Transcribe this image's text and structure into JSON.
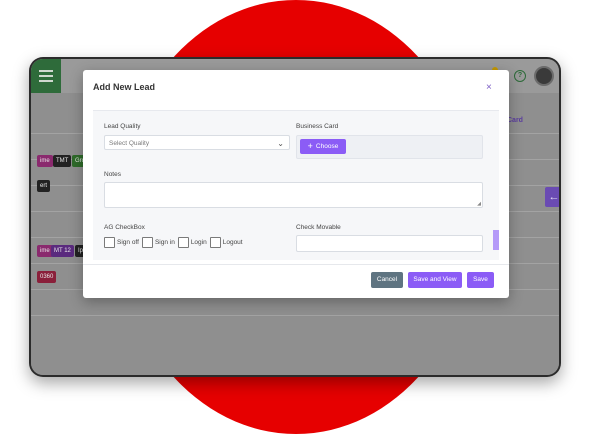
{
  "background": {
    "circle_color": "#e60000"
  },
  "app": {
    "help_icon": "question-circle-icon",
    "bg_table_header": "Card",
    "bg_tags": [
      "ime",
      "TMT",
      "Gro",
      "ert",
      "ime",
      "MT 12",
      "Ip",
      "0360"
    ],
    "side_arrow": "←"
  },
  "modal": {
    "title": "Add New Lead",
    "close": "×",
    "lead_quality": {
      "label": "Lead Quality",
      "placeholder": "Select Quality"
    },
    "business_card": {
      "label": "Business Card",
      "button": "Choose"
    },
    "notes": {
      "label": "Notes",
      "value": ""
    },
    "ag_checkbox": {
      "label": "AG CheckBox",
      "options": [
        "Sign off",
        "Sign in",
        "Login",
        "Logout"
      ]
    },
    "check_movable": {
      "label": "Check Movable",
      "value": ""
    },
    "buttons": {
      "cancel": "Cancel",
      "save_and_view": "Save and View",
      "save": "Save"
    }
  },
  "colors": {
    "accent": "#8b5cf6",
    "cancel": "#5f7481",
    "header_green": "#2e6b3a"
  }
}
